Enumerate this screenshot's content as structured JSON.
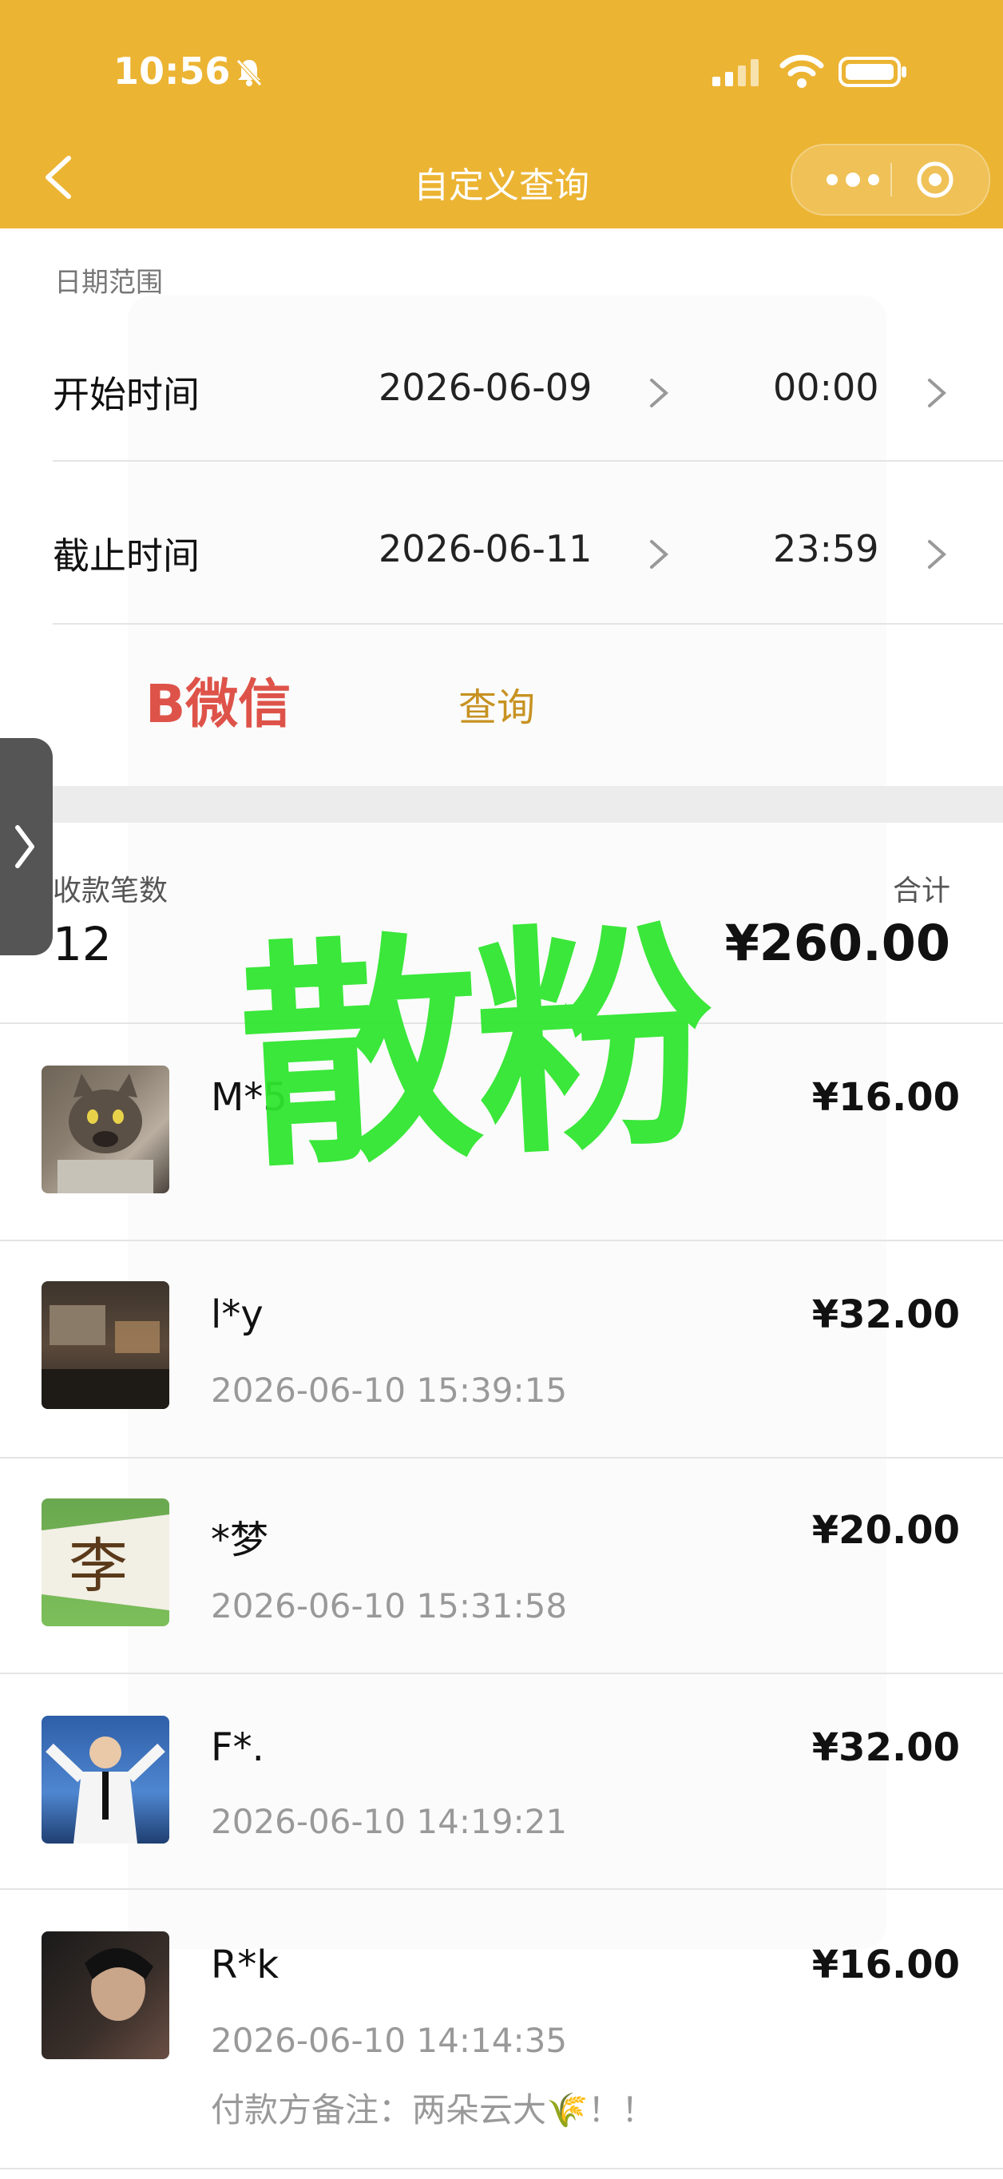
{
  "status_bar": {
    "time": "10:56"
  },
  "nav": {
    "title": "自定义查询"
  },
  "date_range": {
    "section_label": "日期范围",
    "start": {
      "label": "开始时间",
      "date": "2026-06-09",
      "time": "00:00"
    },
    "end": {
      "label": "截止时间",
      "date": "2026-06-11",
      "time": "23:59"
    }
  },
  "query_button": "查询",
  "overlay_brand": "B微信",
  "watermark": "散粉",
  "summary": {
    "count_label": "收款笔数",
    "count": "12",
    "total_label": "合计",
    "total": "¥260.00"
  },
  "transactions": [
    {
      "name": "M*5",
      "amount": "¥16.00",
      "time": "",
      "note": ""
    },
    {
      "name": "l*y",
      "amount": "¥32.00",
      "time": "2026-06-10 15:39:15",
      "note": ""
    },
    {
      "name": "*梦",
      "amount": "¥20.00",
      "time": "2026-06-10 15:31:58",
      "note": ""
    },
    {
      "name": "F*.",
      "amount": "¥32.00",
      "time": "2026-06-10 14:19:21",
      "note": ""
    },
    {
      "name": "R*k",
      "amount": "¥16.00",
      "time": "2026-06-10 14:14:35",
      "note": "付款方备注：两朵云大🌾！！"
    }
  ],
  "avatar_text": {
    "li": "李"
  },
  "colors": {
    "header": "#ECB433",
    "watermark": "#2EE62E",
    "accent": "#C79222"
  },
  "icons": [
    "mute-bell-icon",
    "signal-icon",
    "wifi-icon",
    "battery-icon",
    "back-arrow-icon",
    "more-dots-icon",
    "target-icon",
    "chevron-right-icon",
    "side-expand-icon"
  ]
}
